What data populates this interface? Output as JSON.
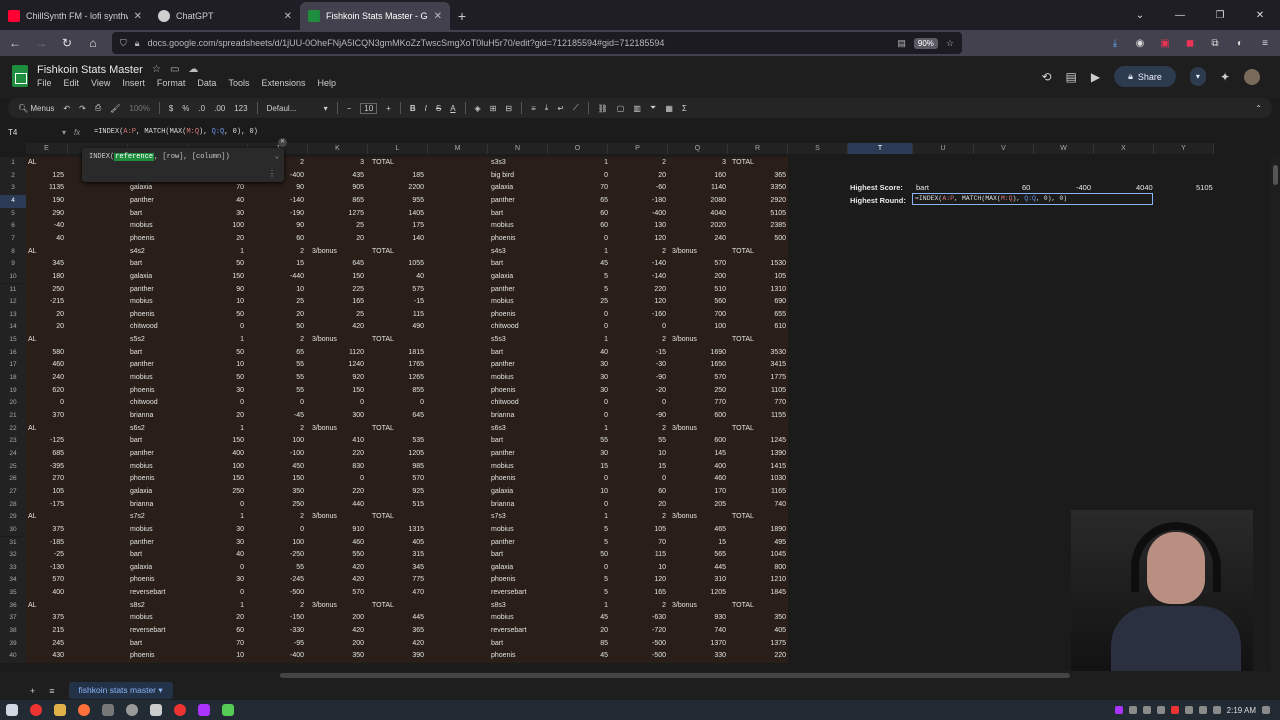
{
  "browser": {
    "tabs": [
      {
        "title": "ChillSynth FM - lofi synthw",
        "icon_color": "#ff0033",
        "active": false
      },
      {
        "title": "ChatGPT",
        "icon_color": "#cfcfcf",
        "active": false
      },
      {
        "title": "Fishkoin Stats Master - Google",
        "icon_color": "#1e8e3e",
        "active": true
      }
    ],
    "new_tab": "+",
    "address": "docs.google.com/spreadsheets/d/1jUU-0OheFNjA5ICQN3gmMKoZzTwscSmgXoT0luH5r70/edit?gid=712185594#gid=712185594",
    "zoom": "90%"
  },
  "app": {
    "title": "Fishkoin Stats Master",
    "menus": [
      "File",
      "Edit",
      "View",
      "Insert",
      "Format",
      "Data",
      "Tools",
      "Extensions",
      "Help"
    ],
    "share_label": "Share",
    "toolbar": {
      "search": "Menus",
      "zoom": "100%",
      "currency": "$",
      "percent": "%",
      "dec_down": ".0",
      "dec_up": ".00",
      "format": "123",
      "font": "Defaul...",
      "font_size": "10"
    },
    "namebox": "T4",
    "formula_parts": [
      "=INDEX(",
      "A:P",
      ", MATCH(MAX(",
      "M:Q",
      "), ",
      "Q:Q",
      ", 0), 0)"
    ]
  },
  "tooltip": {
    "prefix": "INDEX(",
    "highlight": "reference",
    "suffix": ", [row], [column])"
  },
  "columns": [
    "E",
    "",
    "",
    "",
    "J",
    "K",
    "L",
    "M",
    "N",
    "O",
    "P",
    "Q",
    "R",
    "S",
    "T",
    "U",
    "V",
    "W",
    "X",
    "Y"
  ],
  "rows": [
    "1",
    "2",
    "3",
    "4",
    "5",
    "6",
    "7",
    "8",
    "9",
    "10",
    "11",
    "12",
    "13",
    "14",
    "15",
    "16",
    "17",
    "18",
    "19",
    "20",
    "21",
    "22",
    "23",
    "24",
    "25",
    "26",
    "27",
    "28",
    "29",
    "30",
    "31",
    "32",
    "33",
    "34",
    "35",
    "36",
    "37",
    "38",
    "39",
    "40"
  ],
  "left_table": [
    [
      "AL",
      "",
      "",
      "2",
      "3",
      "TOTAL"
    ],
    [
      "125",
      "",
      "",
      "-400",
      "435",
      "185"
    ],
    [
      "1135",
      "galaxia",
      "70",
      "90",
      "905",
      "2200"
    ],
    [
      "190",
      "panther",
      "40",
      "-140",
      "865",
      "955"
    ],
    [
      "290",
      "bart",
      "30",
      "-190",
      "1275",
      "1405"
    ],
    [
      "-40",
      "mobius",
      "100",
      "90",
      "25",
      "175"
    ],
    [
      "40",
      "phoenis",
      "20",
      "60",
      "20",
      "140"
    ],
    [
      "AL",
      "s4s2",
      "1",
      "2",
      "3/bonus",
      "TOTAL"
    ],
    [
      "345",
      "bart",
      "50",
      "15",
      "645",
      "1055"
    ],
    [
      "180",
      "galaxia",
      "150",
      "-440",
      "150",
      "40"
    ],
    [
      "250",
      "panther",
      "90",
      "10",
      "225",
      "575"
    ],
    [
      "-215",
      "mobius",
      "10",
      "25",
      "165",
      "-15"
    ],
    [
      "20",
      "phoenis",
      "50",
      "20",
      "25",
      "115"
    ],
    [
      "20",
      "chitwood",
      "0",
      "50",
      "420",
      "490"
    ],
    [
      "AL",
      "s5s2",
      "1",
      "2",
      "3/bonus",
      "TOTAL"
    ],
    [
      "580",
      "bart",
      "50",
      "65",
      "1120",
      "1815"
    ],
    [
      "460",
      "panther",
      "10",
      "55",
      "1240",
      "1765"
    ],
    [
      "240",
      "mobius",
      "50",
      "55",
      "920",
      "1265"
    ],
    [
      "620",
      "phoenis",
      "30",
      "55",
      "150",
      "855"
    ],
    [
      "0",
      "chitwood",
      "0",
      "0",
      "0",
      "0"
    ],
    [
      "370",
      "brianna",
      "20",
      "-45",
      "300",
      "645"
    ],
    [
      "AL",
      "s6s2",
      "1",
      "2",
      "3/bonus",
      "TOTAL"
    ],
    [
      "-125",
      "bart",
      "150",
      "100",
      "410",
      "535"
    ],
    [
      "685",
      "panther",
      "400",
      "-100",
      "220",
      "1205"
    ],
    [
      "-395",
      "mobius",
      "100",
      "450",
      "830",
      "985"
    ],
    [
      "270",
      "phoenis",
      "150",
      "150",
      "0",
      "570"
    ],
    [
      "105",
      "galaxia",
      "250",
      "350",
      "220",
      "925"
    ],
    [
      "-175",
      "brianna",
      "0",
      "250",
      "440",
      "515"
    ],
    [
      "AL",
      "s7s2",
      "1",
      "2",
      "3/bonus",
      "TOTAL"
    ],
    [
      "375",
      "mobius",
      "30",
      "0",
      "910",
      "1315"
    ],
    [
      "-185",
      "panther",
      "30",
      "100",
      "460",
      "405"
    ],
    [
      "-25",
      "bart",
      "40",
      "-250",
      "550",
      "315"
    ],
    [
      "-130",
      "galaxia",
      "0",
      "55",
      "420",
      "345"
    ],
    [
      "570",
      "phoenis",
      "30",
      "-245",
      "420",
      "775"
    ],
    [
      "400",
      "reversebart",
      "0",
      "-500",
      "570",
      "470"
    ],
    [
      "AL",
      "s8s2",
      "1",
      "2",
      "3/bonus",
      "TOTAL"
    ],
    [
      "375",
      "mobius",
      "20",
      "-150",
      "200",
      "445"
    ],
    [
      "215",
      "reversebart",
      "60",
      "-330",
      "420",
      "365"
    ],
    [
      "245",
      "bart",
      "70",
      "-95",
      "200",
      "420"
    ],
    [
      "430",
      "phoenis",
      "10",
      "-400",
      "350",
      "390"
    ]
  ],
  "right_table": [
    [
      "s3s3",
      "1",
      "2",
      "3",
      "TOTAL"
    ],
    [
      "big bird",
      "0",
      "20",
      "160",
      "365"
    ],
    [
      "galaxia",
      "70",
      "-60",
      "1140",
      "3350"
    ],
    [
      "panther",
      "65",
      "-180",
      "2080",
      "2920"
    ],
    [
      "bart",
      "60",
      "-400",
      "4040",
      "5105"
    ],
    [
      "mobius",
      "60",
      "130",
      "2020",
      "2385"
    ],
    [
      "phoenis",
      "0",
      "120",
      "240",
      "500"
    ],
    [
      "s4s3",
      "1",
      "2",
      "3/bonus",
      "TOTAL"
    ],
    [
      "bart",
      "45",
      "-140",
      "570",
      "1530"
    ],
    [
      "galaxia",
      "5",
      "-140",
      "200",
      "105"
    ],
    [
      "panther",
      "5",
      "220",
      "510",
      "1310"
    ],
    [
      "mobius",
      "25",
      "120",
      "560",
      "690"
    ],
    [
      "phoenis",
      "0",
      "-160",
      "700",
      "655"
    ],
    [
      "chitwood",
      "0",
      "0",
      "100",
      "610"
    ],
    [
      "s5s3",
      "1",
      "2",
      "3/bonus",
      "TOTAL"
    ],
    [
      "bart",
      "40",
      "-15",
      "1690",
      "3530"
    ],
    [
      "panther",
      "30",
      "-30",
      "1650",
      "3415"
    ],
    [
      "mobius",
      "30",
      "-90",
      "570",
      "1775"
    ],
    [
      "phoenis",
      "30",
      "-20",
      "250",
      "1105"
    ],
    [
      "chitwood",
      "0",
      "0",
      "770",
      "770"
    ],
    [
      "brianna",
      "0",
      "-90",
      "600",
      "1155"
    ],
    [
      "s6s3",
      "1",
      "2",
      "3/bonus",
      "TOTAL"
    ],
    [
      "bart",
      "55",
      "55",
      "600",
      "1245"
    ],
    [
      "panther",
      "30",
      "10",
      "145",
      "1390"
    ],
    [
      "mobius",
      "15",
      "15",
      "400",
      "1415"
    ],
    [
      "phoenis",
      "0",
      "0",
      "460",
      "1030"
    ],
    [
      "galaxia",
      "10",
      "60",
      "170",
      "1165"
    ],
    [
      "brianna",
      "0",
      "20",
      "205",
      "740"
    ],
    [
      "s7s3",
      "1",
      "2",
      "3/bonus",
      "TOTAL"
    ],
    [
      "mobius",
      "5",
      "105",
      "465",
      "1890"
    ],
    [
      "panther",
      "5",
      "70",
      "15",
      "495"
    ],
    [
      "bart",
      "50",
      "115",
      "565",
      "1045"
    ],
    [
      "galaxia",
      "0",
      "10",
      "445",
      "800"
    ],
    [
      "phoenis",
      "5",
      "120",
      "310",
      "1210"
    ],
    [
      "reversebart",
      "5",
      "165",
      "1205",
      "1845"
    ],
    [
      "s8s3",
      "1",
      "2",
      "3/bonus",
      "TOTAL"
    ],
    [
      "mobius",
      "45",
      "-630",
      "930",
      "350"
    ],
    [
      "reversebart",
      "20",
      "-720",
      "740",
      "405"
    ],
    [
      "bart",
      "85",
      "-500",
      "1370",
      "1375"
    ],
    [
      "phoenis",
      "45",
      "-500",
      "330",
      "220"
    ]
  ],
  "stats": {
    "highest_score_label": "Highest Score:",
    "highest_score_values": [
      "bart",
      "60",
      "-400",
      "4040",
      "5105"
    ],
    "highest_round_label": "Highest Round:",
    "edit_parts": [
      "=INDEX(",
      "A:P",
      ", MATCH(MAX(",
      "M:Q",
      "), ",
      "Q:Q",
      ", 0), 0)"
    ]
  },
  "sheet_tab": "fishkoin stats master",
  "clock": "2:19 AM"
}
